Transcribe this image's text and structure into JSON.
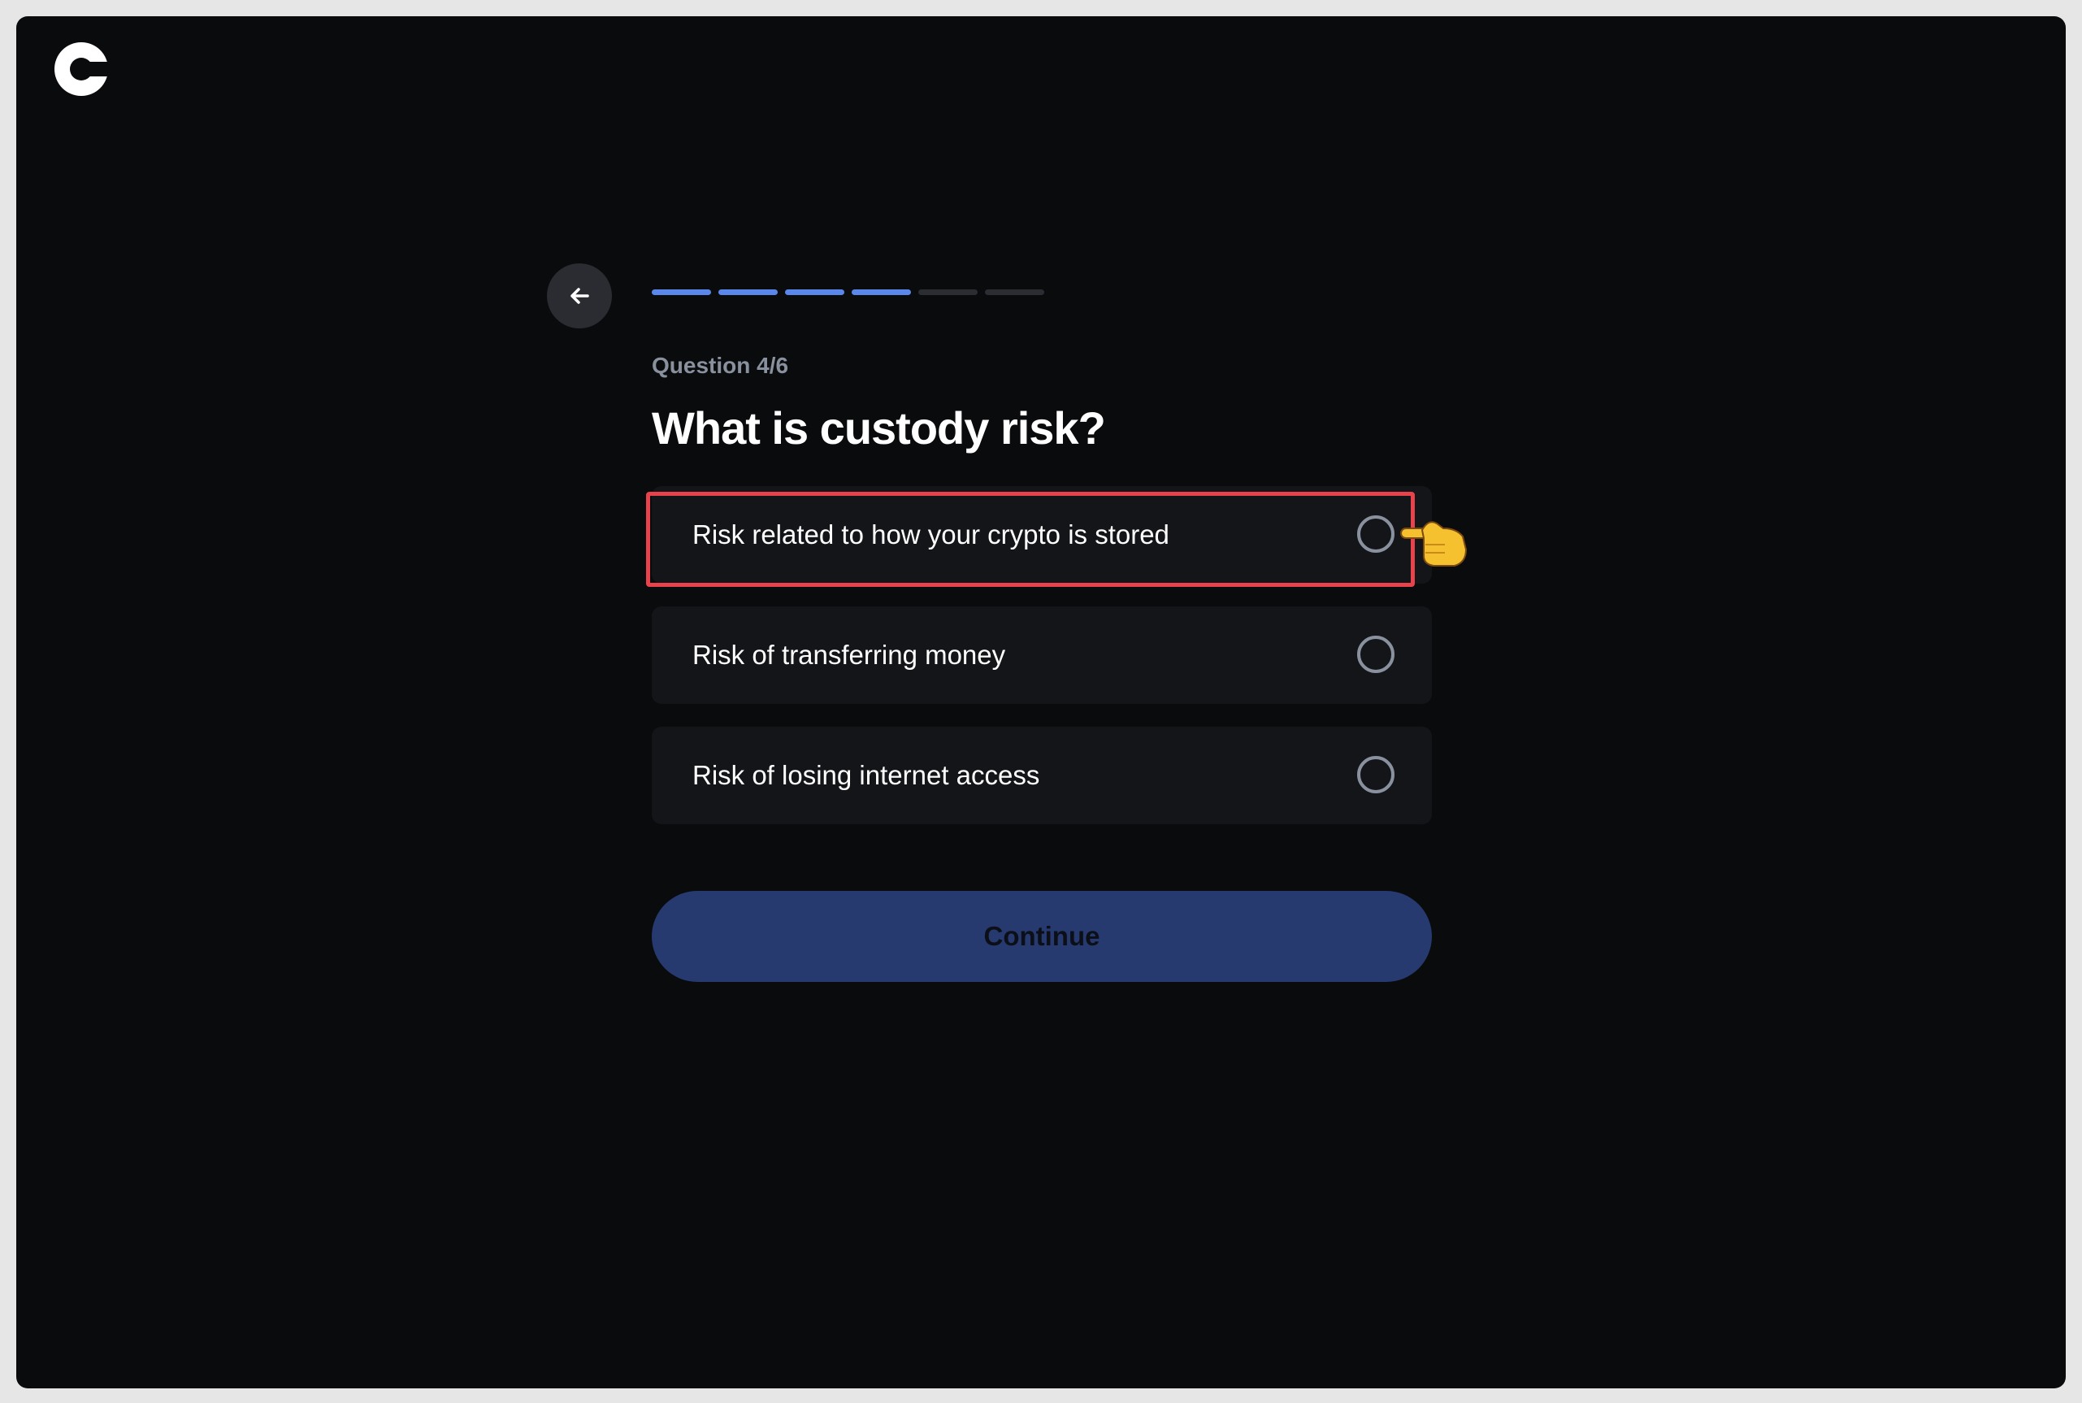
{
  "header": {
    "logo_icon": "coinbase-c-logo"
  },
  "nav": {
    "back_icon": "arrow-left-icon"
  },
  "progress": {
    "current": 4,
    "total": 6
  },
  "quiz": {
    "question_number": "Question 4/6",
    "question": "What is custody risk?",
    "options": [
      {
        "label": "Risk related to how your crypto is stored",
        "selected": false
      },
      {
        "label": "Risk of transferring money",
        "selected": false
      },
      {
        "label": "Risk of losing internet access",
        "selected": false
      }
    ],
    "continue_label": "Continue"
  },
  "colors": {
    "background": "#0a0b0d",
    "accent": "#5a87ec",
    "progress_inactive": "#2b2d33",
    "option_bg": "#141519",
    "continue_bg": "#263a70",
    "highlight": "#e8434c"
  }
}
